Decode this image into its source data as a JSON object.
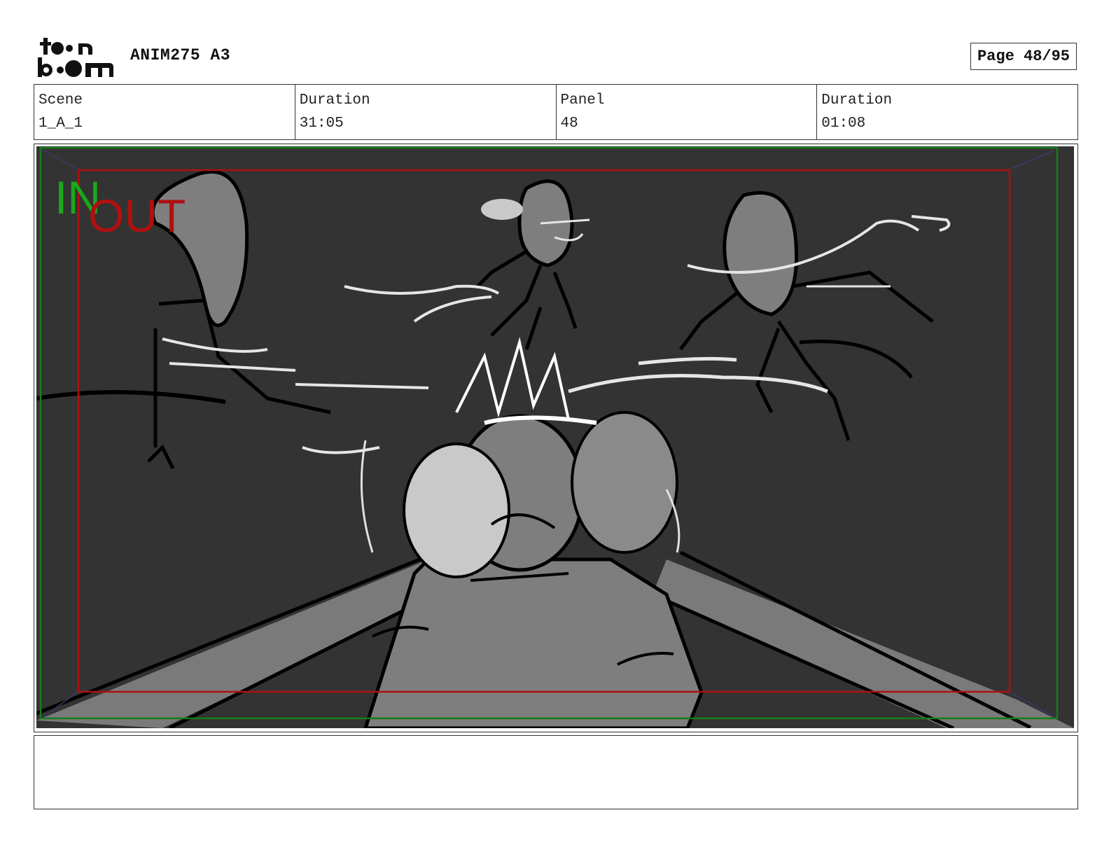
{
  "header": {
    "logo_text": "toon boom",
    "project_title": "ANIM275 A3",
    "page_label": "Page 48/95"
  },
  "info": {
    "scene_label": "Scene",
    "scene_value": "1_A_1",
    "scene_duration_label": "Duration",
    "scene_duration_value": "31:05",
    "panel_label": "Panel",
    "panel_value": "48",
    "panel_duration_label": "Duration",
    "panel_duration_value": "01:08"
  },
  "panel": {
    "in_label": "IN",
    "out_label": "OUT",
    "background_color": "#333333",
    "in_frame_color": "#1a7a1a",
    "out_frame_color": "#b01010"
  },
  "notes": {
    "text": ""
  }
}
